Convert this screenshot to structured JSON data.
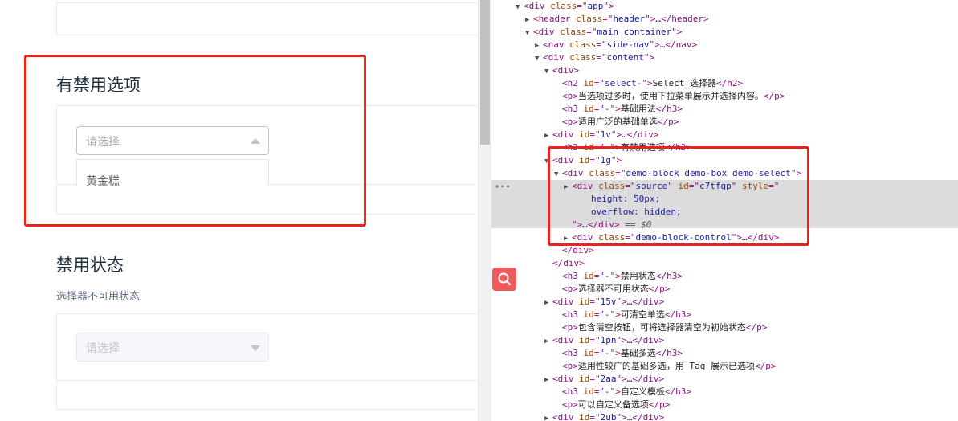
{
  "left": {
    "section_disabled_option": {
      "title": "有禁用选项",
      "select_placeholder": "请选择",
      "dropdown_option": "黄金糕"
    },
    "section_disabled_state": {
      "title": "禁用状态",
      "desc": "选择器不可用状态",
      "select_placeholder": "请选择"
    }
  },
  "devtools": {
    "lines": [
      {
        "indent": 0,
        "tri": "▼",
        "parts": [
          [
            "tag",
            "<div "
          ],
          [
            "attr",
            "class"
          ],
          [
            "tag",
            "=\""
          ],
          [
            "val",
            "app"
          ],
          [
            "tag",
            "\">"
          ]
        ]
      },
      {
        "indent": 1,
        "tri": "▶",
        "parts": [
          [
            "tag",
            "<header "
          ],
          [
            "attr",
            "class"
          ],
          [
            "tag",
            "=\""
          ],
          [
            "val",
            "header"
          ],
          [
            "tag",
            "\">"
          ],
          [
            "txt",
            "…"
          ],
          [
            "tag",
            "</header>"
          ]
        ]
      },
      {
        "indent": 1,
        "tri": "▼",
        "parts": [
          [
            "tag",
            "<div "
          ],
          [
            "attr",
            "class"
          ],
          [
            "tag",
            "=\""
          ],
          [
            "val",
            "main container"
          ],
          [
            "tag",
            "\">"
          ]
        ]
      },
      {
        "indent": 2,
        "tri": "▶",
        "parts": [
          [
            "tag",
            "<nav "
          ],
          [
            "attr",
            "class"
          ],
          [
            "tag",
            "=\""
          ],
          [
            "val",
            "side-nav"
          ],
          [
            "tag",
            "\">"
          ],
          [
            "txt",
            "…"
          ],
          [
            "tag",
            "</nav>"
          ]
        ]
      },
      {
        "indent": 2,
        "tri": "▼",
        "parts": [
          [
            "tag",
            "<div "
          ],
          [
            "attr",
            "class"
          ],
          [
            "tag",
            "=\""
          ],
          [
            "val",
            "content"
          ],
          [
            "tag",
            "\">"
          ]
        ]
      },
      {
        "indent": 3,
        "tri": "▼",
        "parts": [
          [
            "tag",
            "<div>"
          ]
        ]
      },
      {
        "indent": 4,
        "tri": "",
        "parts": [
          [
            "tag",
            "<h2 "
          ],
          [
            "attr",
            "id"
          ],
          [
            "tag",
            "=\""
          ],
          [
            "val",
            "select-"
          ],
          [
            "tag",
            "\">"
          ],
          [
            "txt",
            "Select 选择器"
          ],
          [
            "tag",
            "</h2>"
          ]
        ]
      },
      {
        "indent": 4,
        "tri": "",
        "parts": [
          [
            "tag",
            "<p>"
          ],
          [
            "txt",
            "当选项过多时，使用下拉菜单展示并选择内容。"
          ],
          [
            "tag",
            "</p>"
          ]
        ]
      },
      {
        "indent": 4,
        "tri": "",
        "parts": [
          [
            "tag",
            "<h3 "
          ],
          [
            "attr",
            "id"
          ],
          [
            "tag",
            "=\""
          ],
          [
            "val",
            "-"
          ],
          [
            "tag",
            "\">"
          ],
          [
            "txt",
            "基础用法"
          ],
          [
            "tag",
            "</h3>"
          ]
        ]
      },
      {
        "indent": 4,
        "tri": "",
        "parts": [
          [
            "tag",
            "<p>"
          ],
          [
            "txt",
            "适用广泛的基础单选"
          ],
          [
            "tag",
            "</p>"
          ]
        ]
      },
      {
        "indent": 3,
        "tri": "▶",
        "parts": [
          [
            "tag",
            "<div "
          ],
          [
            "attr",
            "id"
          ],
          [
            "tag",
            "=\""
          ],
          [
            "val",
            "1v"
          ],
          [
            "tag",
            "\">"
          ],
          [
            "txt",
            "…"
          ],
          [
            "tag",
            "</div>"
          ]
        ]
      },
      {
        "indent": 4,
        "tri": "",
        "parts": [
          [
            "tag",
            "<h3 "
          ],
          [
            "attr",
            "id"
          ],
          [
            "tag",
            "=\""
          ],
          [
            "val",
            "-"
          ],
          [
            "tag",
            "\">"
          ],
          [
            "txt",
            "有禁用选项"
          ],
          [
            "tag",
            "</h3>"
          ]
        ]
      },
      {
        "indent": 3,
        "tri": "▼",
        "parts": [
          [
            "tag",
            "<div "
          ],
          [
            "attr",
            "id"
          ],
          [
            "tag",
            "=\""
          ],
          [
            "val",
            "1g"
          ],
          [
            "tag",
            "\">"
          ]
        ]
      },
      {
        "indent": 4,
        "tri": "▼",
        "parts": [
          [
            "tag",
            "<div "
          ],
          [
            "attr",
            "class"
          ],
          [
            "tag",
            "=\""
          ],
          [
            "val",
            "demo-block demo-box demo-select"
          ],
          [
            "tag",
            "\">"
          ]
        ]
      },
      {
        "indent": 5,
        "tri": "▶",
        "parts": [
          [
            "tag",
            "<div "
          ],
          [
            "attr",
            "class"
          ],
          [
            "tag",
            "=\""
          ],
          [
            "val",
            "source"
          ],
          [
            "tag",
            "\" "
          ],
          [
            "attr",
            "id"
          ],
          [
            "tag",
            "=\""
          ],
          [
            "val",
            "c7tfgp"
          ],
          [
            "tag",
            "\" "
          ],
          [
            "attr",
            "style"
          ],
          [
            "tag",
            "=\""
          ]
        ]
      },
      {
        "indent": 7,
        "tri": "",
        "parts": [
          [
            "val",
            "height: 50px;"
          ]
        ]
      },
      {
        "indent": 7,
        "tri": "",
        "parts": [
          [
            "val",
            "overflow: hidden;"
          ]
        ]
      },
      {
        "indent": 5,
        "tri": "",
        "parts": [
          [
            "tag",
            "\">"
          ],
          [
            "txt",
            "…"
          ],
          [
            "tag",
            "</div>"
          ],
          [
            "eq0",
            " == $0"
          ]
        ]
      },
      {
        "indent": 5,
        "tri": "▶",
        "parts": [
          [
            "tag",
            "<div "
          ],
          [
            "attr",
            "class"
          ],
          [
            "tag",
            "=\""
          ],
          [
            "val",
            "demo-block-control"
          ],
          [
            "tag",
            "\">"
          ],
          [
            "txt",
            "…"
          ],
          [
            "tag",
            "</div>"
          ]
        ]
      },
      {
        "indent": 4,
        "tri": "",
        "parts": [
          [
            "tag",
            "</div>"
          ]
        ]
      },
      {
        "indent": 3,
        "tri": "",
        "parts": [
          [
            "tag",
            "</div>"
          ]
        ]
      },
      {
        "indent": 4,
        "tri": "",
        "parts": [
          [
            "tag",
            "<h3 "
          ],
          [
            "attr",
            "id"
          ],
          [
            "tag",
            "=\""
          ],
          [
            "val",
            "-"
          ],
          [
            "tag",
            "\">"
          ],
          [
            "txt",
            "禁用状态"
          ],
          [
            "tag",
            "</h3>"
          ]
        ]
      },
      {
        "indent": 4,
        "tri": "",
        "parts": [
          [
            "tag",
            "<p>"
          ],
          [
            "txt",
            "选择器不可用状态"
          ],
          [
            "tag",
            "</p>"
          ]
        ]
      },
      {
        "indent": 3,
        "tri": "▶",
        "parts": [
          [
            "tag",
            "<div "
          ],
          [
            "attr",
            "id"
          ],
          [
            "tag",
            "=\""
          ],
          [
            "val",
            "15v"
          ],
          [
            "tag",
            "\">"
          ],
          [
            "txt",
            "…"
          ],
          [
            "tag",
            "</div>"
          ]
        ]
      },
      {
        "indent": 4,
        "tri": "",
        "parts": [
          [
            "tag",
            "<h3 "
          ],
          [
            "attr",
            "id"
          ],
          [
            "tag",
            "=\""
          ],
          [
            "val",
            "-"
          ],
          [
            "tag",
            "\">"
          ],
          [
            "txt",
            "可清空单选"
          ],
          [
            "tag",
            "</h3>"
          ]
        ]
      },
      {
        "indent": 4,
        "tri": "",
        "parts": [
          [
            "tag",
            "<p>"
          ],
          [
            "txt",
            "包含清空按钮，可将选择器清空为初始状态"
          ],
          [
            "tag",
            "</p>"
          ]
        ]
      },
      {
        "indent": 3,
        "tri": "▶",
        "parts": [
          [
            "tag",
            "<div "
          ],
          [
            "attr",
            "id"
          ],
          [
            "tag",
            "=\""
          ],
          [
            "val",
            "1pn"
          ],
          [
            "tag",
            "\">"
          ],
          [
            "txt",
            "…"
          ],
          [
            "tag",
            "</div>"
          ]
        ]
      },
      {
        "indent": 4,
        "tri": "",
        "parts": [
          [
            "tag",
            "<h3 "
          ],
          [
            "attr",
            "id"
          ],
          [
            "tag",
            "=\""
          ],
          [
            "val",
            "-"
          ],
          [
            "tag",
            "\">"
          ],
          [
            "txt",
            "基础多选"
          ],
          [
            "tag",
            "</h3>"
          ]
        ]
      },
      {
        "indent": 4,
        "tri": "",
        "parts": [
          [
            "tag",
            "<p>"
          ],
          [
            "txt",
            "适用性较广的基础多选，用 Tag 展示已选项"
          ],
          [
            "tag",
            "</p>"
          ]
        ]
      },
      {
        "indent": 3,
        "tri": "▶",
        "parts": [
          [
            "tag",
            "<div "
          ],
          [
            "attr",
            "id"
          ],
          [
            "tag",
            "=\""
          ],
          [
            "val",
            "2aa"
          ],
          [
            "tag",
            "\">"
          ],
          [
            "txt",
            "…"
          ],
          [
            "tag",
            "</div>"
          ]
        ]
      },
      {
        "indent": 4,
        "tri": "",
        "parts": [
          [
            "tag",
            "<h3 "
          ],
          [
            "attr",
            "id"
          ],
          [
            "tag",
            "=\""
          ],
          [
            "val",
            "-"
          ],
          [
            "tag",
            "\">"
          ],
          [
            "txt",
            "自定义模板"
          ],
          [
            "tag",
            "</h3>"
          ]
        ]
      },
      {
        "indent": 4,
        "tri": "",
        "parts": [
          [
            "tag",
            "<p>"
          ],
          [
            "txt",
            "可以自定义备选项"
          ],
          [
            "tag",
            "</p>"
          ]
        ]
      },
      {
        "indent": 3,
        "tri": "▶",
        "parts": [
          [
            "tag",
            "<div "
          ],
          [
            "attr",
            "id"
          ],
          [
            "tag",
            "=\""
          ],
          [
            "val",
            "2ub"
          ],
          [
            "tag",
            "\">"
          ],
          [
            "txt",
            "…"
          ],
          [
            "tag",
            "</div>"
          ]
        ]
      }
    ]
  }
}
